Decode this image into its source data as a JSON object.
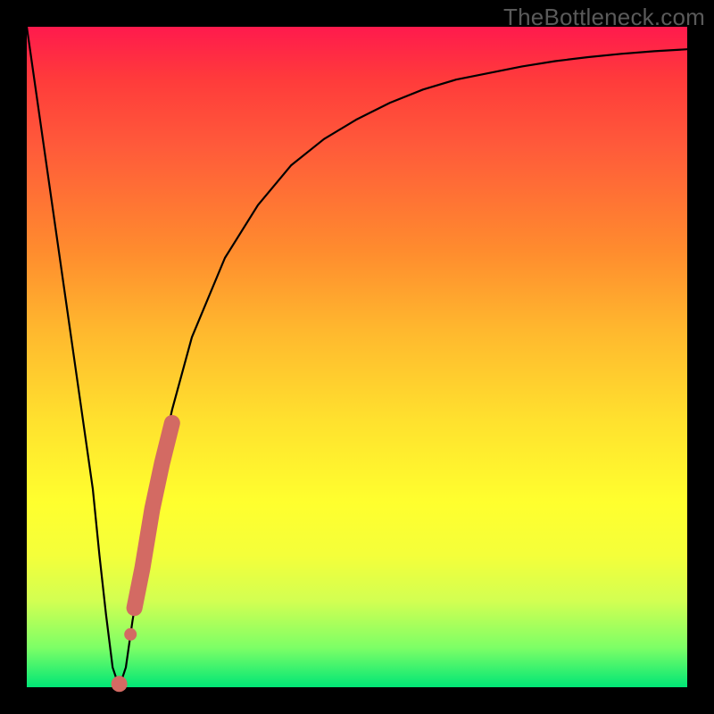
{
  "watermark": "TheBottleneck.com",
  "chart_data": {
    "type": "line",
    "title": "",
    "xlabel": "",
    "ylabel": "",
    "xlim": [
      0,
      100
    ],
    "ylim": [
      0,
      100
    ],
    "series": [
      {
        "name": "bottleneck-curve",
        "x": [
          0,
          2,
          4,
          6,
          8,
          10,
          11,
          12,
          13,
          14,
          15,
          16,
          18,
          20,
          22,
          25,
          30,
          35,
          40,
          45,
          50,
          55,
          60,
          65,
          70,
          75,
          80,
          85,
          90,
          95,
          100
        ],
        "y": [
          100,
          86,
          72,
          58,
          44,
          30,
          20,
          11,
          3,
          0,
          3,
          10,
          22,
          33,
          42,
          53,
          65,
          73,
          79,
          83,
          86,
          88.5,
          90.5,
          92,
          93,
          94,
          94.8,
          95.4,
          95.9,
          96.3,
          96.6
        ]
      }
    ],
    "highlight": {
      "name": "highlight-segment",
      "color": "#d36a63",
      "x": [
        14.0,
        15.0,
        15.7,
        16.3,
        17.5,
        19.0,
        20.5,
        22.0
      ],
      "y": [
        0.5,
        3.0,
        8.0,
        12.0,
        18.0,
        27.0,
        34.0,
        40.0
      ]
    }
  }
}
